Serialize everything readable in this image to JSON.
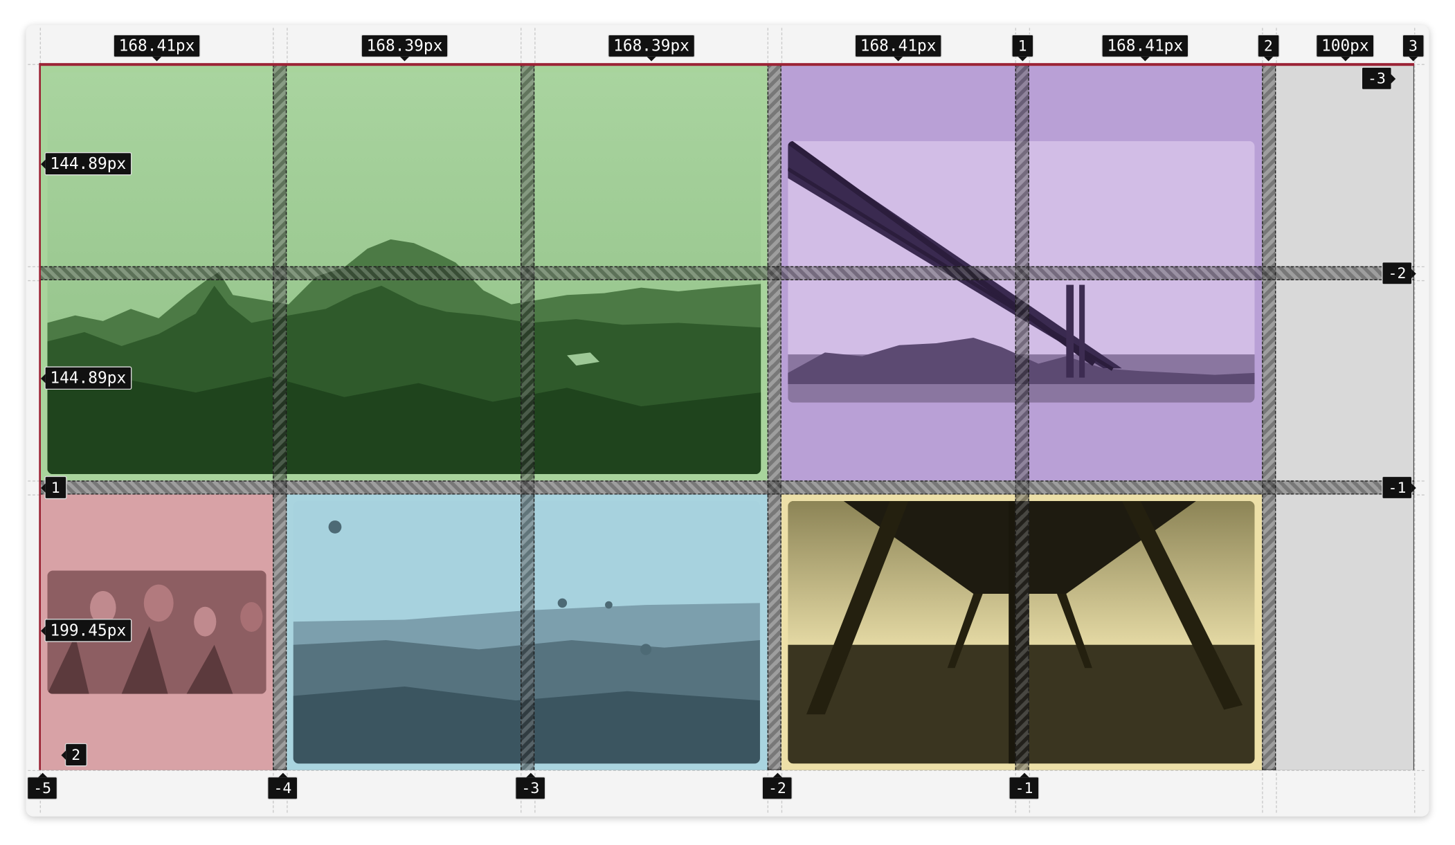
{
  "inspector": {
    "column_sizes": [
      "168.41px",
      "168.39px",
      "168.39px",
      "168.41px",
      "168.41px",
      "100px"
    ],
    "row_sizes": [
      "144.89px",
      "144.89px",
      "199.45px"
    ],
    "column_line_numbers_top": [
      "1",
      "2",
      "3"
    ],
    "column_line_numbers_bottom": [
      "-5",
      "-4",
      "-3",
      "-2",
      "-1"
    ],
    "row_line_numbers_left": [
      "1",
      "2"
    ],
    "row_line_numbers_right": [
      "-3",
      "-2",
      "-1"
    ]
  },
  "areas": {
    "mountains": {
      "color": "#a8d49c",
      "icon": "mountains-photo"
    },
    "bridge": {
      "color": "#b9a0d6",
      "icon": "bridge-photo"
    },
    "tulips": {
      "color": "#d8a2a6",
      "icon": "tulips-photo"
    },
    "balloons": {
      "color": "#a9d4df",
      "icon": "balloons-photo"
    },
    "pier": {
      "color": "#ede0a8",
      "icon": "pier-photo"
    },
    "empty_track": {
      "color": "#d9d9d9"
    }
  }
}
